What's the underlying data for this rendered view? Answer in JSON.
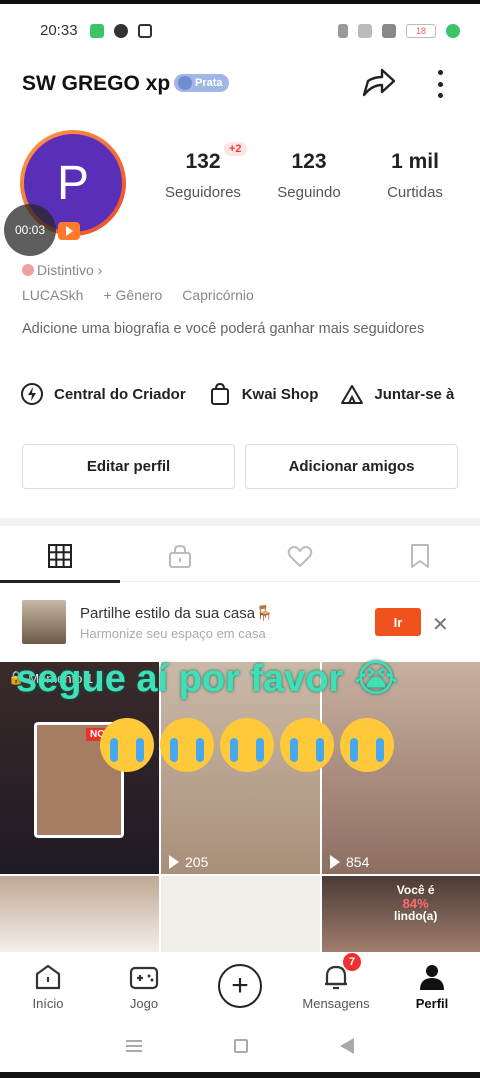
{
  "status_bar": {
    "time": "20:33",
    "battery": "18"
  },
  "header": {
    "username": "SW GREGO xp",
    "badge": "Prata"
  },
  "profile": {
    "avatar_letter": "P",
    "video_time": "00:03",
    "stats": [
      {
        "value": "132",
        "label": "Seguidores",
        "badge": "+2"
      },
      {
        "value": "123",
        "label": "Seguindo"
      },
      {
        "value": "1 mil",
        "label": "Curtidas"
      }
    ],
    "distintivo": "Distintivo ›",
    "meta": [
      "LUCASkh",
      "+ Gênero",
      "Capricórnio"
    ],
    "bio": "Adicione uma biografia e você poderá ganhar mais seguidores"
  },
  "quick_links": [
    "Central do Criador",
    "Kwai Shop",
    "Juntar-se à"
  ],
  "actions": {
    "edit": "Editar perfil",
    "add_friends": "Adicionar amigos"
  },
  "promo": {
    "title": "Partilhe estilo da sua casa🪑",
    "subtitle": "Harmonize seu espaço em casa",
    "button": "Ir"
  },
  "grid": {
    "pinned_label": "Momento 1",
    "overlay_text": "segue aí por favor 😭",
    "views": [
      "205",
      "854"
    ],
    "card_tag": "NO",
    "percent_top": "Você é",
    "percent_value": "84%",
    "percent_bottom": "lindo(a)"
  },
  "bottom_nav": {
    "items": [
      "Início",
      "Jogo",
      "Mensagens",
      "Perfil"
    ],
    "messages_badge": "7"
  },
  "colors": {
    "accent": "#f0521e",
    "overlay": "#3fe0b8",
    "badge_red": "#f03030"
  }
}
